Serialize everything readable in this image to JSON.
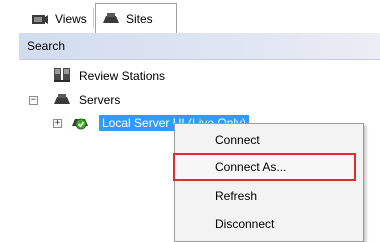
{
  "tabs": {
    "views_label": "Views",
    "sites_label": "Sites"
  },
  "search": {
    "label": "Search"
  },
  "tree": {
    "review_stations": "Review Stations",
    "servers": "Servers",
    "servers_expander": "−",
    "local_server": "Local Server UI (Live Only)",
    "local_server_expander": "+"
  },
  "context_menu": {
    "items": [
      "Connect",
      "Connect As...",
      "Refresh",
      "Disconnect"
    ],
    "highlighted_item": "Connect As..."
  },
  "colors": {
    "selection": "#3399ff",
    "highlight_border": "#d9302d"
  }
}
